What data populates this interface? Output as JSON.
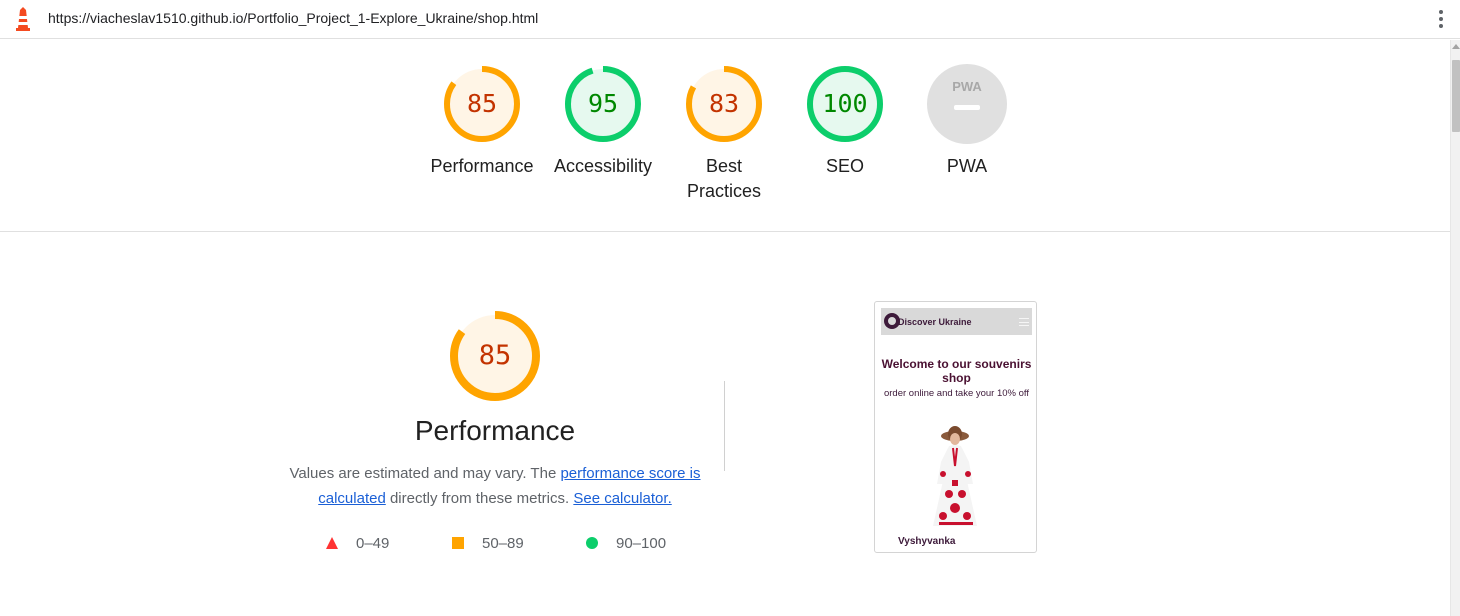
{
  "browser": {
    "url": "https://viacheslav1510.github.io/Portfolio_Project_1-Explore_Ukraine/shop.html",
    "logo_icon": "lighthouse-icon",
    "menu_icon": "more-vert-icon"
  },
  "colors": {
    "pass": "#0cce6b",
    "pass_text": "#008800",
    "pass_bg": "#e6f9ef",
    "average": "#ffa400",
    "average_text": "#c33300",
    "average_bg": "#fff5e6",
    "fail": "#ff3333",
    "na": "#e0e0e0",
    "link": "#1a5fd6"
  },
  "summary": [
    {
      "name": "Performance",
      "score": "85",
      "fraction": 0.85,
      "rating": "average"
    },
    {
      "name": "Accessibility",
      "score": "95",
      "fraction": 0.95,
      "rating": "pass"
    },
    {
      "name": "Best Practices",
      "score": "83",
      "fraction": 0.83,
      "rating": "average"
    },
    {
      "name": "SEO",
      "score": "100",
      "fraction": 1.0,
      "rating": "pass"
    },
    {
      "name": "PWA",
      "score": "",
      "badge": "PWA",
      "rating": "na"
    }
  ],
  "performance": {
    "score": "85",
    "fraction": 0.85,
    "title": "Performance",
    "desc_prefix": "Values are estimated and may vary. The ",
    "link_score": "performance score is calculated",
    "desc_middle": " directly from these metrics. ",
    "link_calculator": "See calculator.",
    "legend": [
      {
        "range": "0–49",
        "icon": "triangle-icon",
        "rating": "fail"
      },
      {
        "range": "50–89",
        "icon": "square-icon",
        "rating": "average"
      },
      {
        "range": "90–100",
        "icon": "circle-icon",
        "rating": "pass"
      }
    ]
  },
  "screenshot": {
    "brand": "Discover Ukraine",
    "heading": "Welcome to our souvenirs shop",
    "subheading": "order online and take your 10% off",
    "caption": "Vyshyvanka"
  }
}
